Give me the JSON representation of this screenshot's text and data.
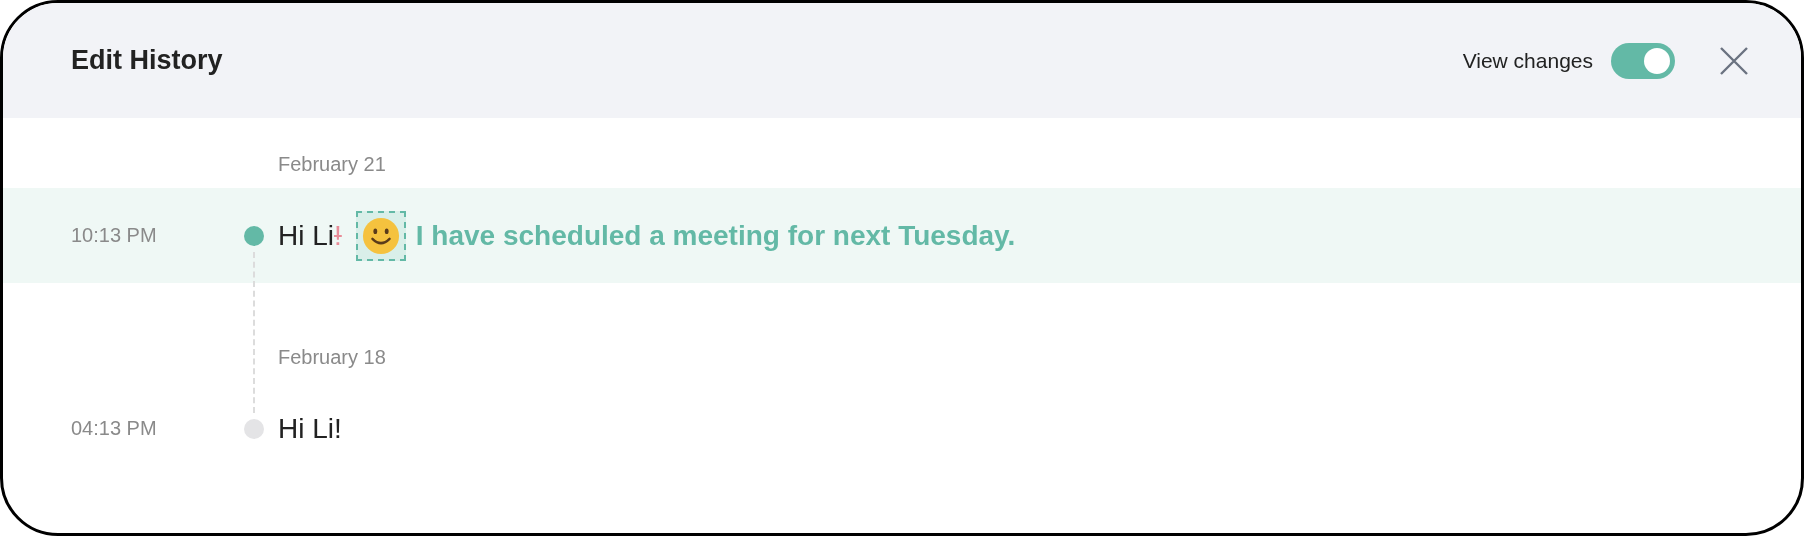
{
  "header": {
    "title": "Edit History",
    "view_changes": {
      "label": "View changes",
      "on": true
    }
  },
  "entries": [
    {
      "date": "February 21",
      "time": "10:13 PM",
      "selected": true,
      "segments": [
        {
          "kind": "text",
          "text": "Hi Li"
        },
        {
          "kind": "deleted",
          "text": "!"
        },
        {
          "kind": "emoji",
          "added": true
        },
        {
          "kind": "added",
          "text": "I have scheduled a meeting for next Tuesday."
        }
      ]
    },
    {
      "date": "February 18",
      "time": "04:13 PM",
      "selected": false,
      "segments": [
        {
          "kind": "text",
          "text": "Hi Li!"
        }
      ]
    }
  ]
}
